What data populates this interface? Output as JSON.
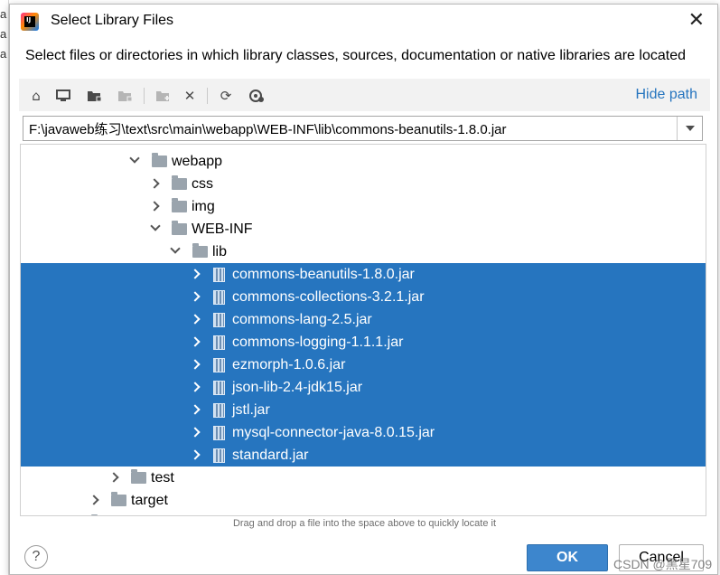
{
  "window": {
    "title": "Select Library Files",
    "description": "Select files or directories in which library classes, sources, documentation or native libraries are located",
    "hide_path_label": "Hide path"
  },
  "toolbar": {
    "buttons": [
      {
        "icon": "home-icon"
      },
      {
        "icon": "desktop-icon"
      },
      {
        "icon": "project-folder-icon"
      },
      {
        "icon": "module-folder-icon",
        "enabled": false
      },
      {
        "icon": "new-folder-icon",
        "enabled": false
      },
      {
        "icon": "delete-icon"
      },
      {
        "icon": "refresh-icon"
      },
      {
        "icon": "show-hidden-icon"
      }
    ]
  },
  "path": {
    "value": "F:\\javaweb练习\\text\\src\\main\\webapp\\WEB-INF\\lib\\commons-beanutils-1.8.0.jar"
  },
  "tree": {
    "items": [
      {
        "label": "webapp",
        "type": "folder",
        "expanded": true,
        "selected": false
      },
      {
        "label": "css",
        "type": "folder",
        "expanded": false,
        "selected": false
      },
      {
        "label": "img",
        "type": "folder",
        "expanded": false,
        "selected": false
      },
      {
        "label": "WEB-INF",
        "type": "folder",
        "expanded": true,
        "selected": false
      },
      {
        "label": "lib",
        "type": "folder",
        "expanded": true,
        "selected": false
      },
      {
        "label": "commons-beanutils-1.8.0.jar",
        "type": "jar",
        "expanded": false,
        "selected": true
      },
      {
        "label": "commons-collections-3.2.1.jar",
        "type": "jar",
        "expanded": false,
        "selected": true
      },
      {
        "label": "commons-lang-2.5.jar",
        "type": "jar",
        "expanded": false,
        "selected": true
      },
      {
        "label": "commons-logging-1.1.1.jar",
        "type": "jar",
        "expanded": false,
        "selected": true
      },
      {
        "label": "ezmorph-1.0.6.jar",
        "type": "jar",
        "expanded": false,
        "selected": true
      },
      {
        "label": "json-lib-2.4-jdk15.jar",
        "type": "jar",
        "expanded": false,
        "selected": true
      },
      {
        "label": "jstl.jar",
        "type": "jar",
        "expanded": false,
        "selected": true
      },
      {
        "label": "mysql-connector-java-8.0.15.jar",
        "type": "jar",
        "expanded": false,
        "selected": true
      },
      {
        "label": "standard.jar",
        "type": "jar",
        "expanded": false,
        "selected": true
      },
      {
        "label": "test",
        "type": "folder",
        "expanded": false,
        "selected": false
      },
      {
        "label": "target",
        "type": "folder",
        "expanded": false,
        "selected": false
      }
    ]
  },
  "hint": "Drag and drop a file into the space above to quickly locate it",
  "buttons": {
    "help": "?",
    "ok": "OK",
    "cancel": "Cancel"
  },
  "watermark": "CSDN @黑星709",
  "colors": {
    "selection": "#2675bf",
    "link": "#2675bf",
    "ok_button": "#3d86cd"
  }
}
